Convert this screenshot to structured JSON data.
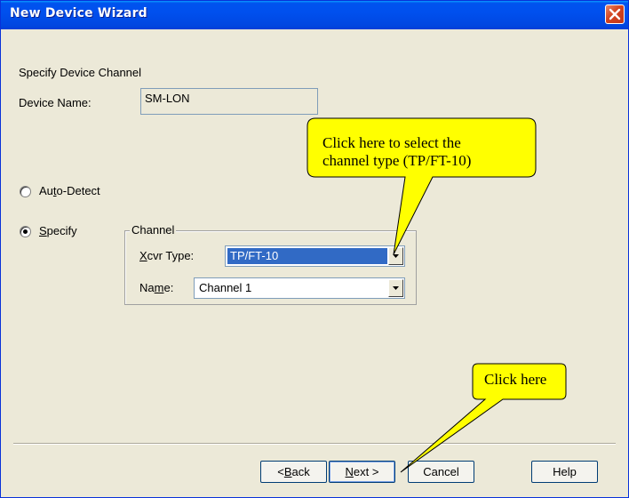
{
  "window": {
    "title": "New Device Wizard"
  },
  "page": {
    "heading": "Specify Device Channel",
    "device_name_label": "Device Name:",
    "device_name_value": "SM-LON"
  },
  "radios": {
    "auto_detect": {
      "label_hot": "Au",
      "label_ul": "t",
      "label_rest": "o-Detect",
      "checked": false
    },
    "specify": {
      "label_hot": "",
      "label_ul": "S",
      "label_rest": "pecify",
      "checked": true
    }
  },
  "channel_group": {
    "legend": "Channel",
    "xcvr_label_ul": "X",
    "xcvr_label_rest": "cvr Type:",
    "xcvr_value": "TP/FT-10",
    "name_label_hot": "Na",
    "name_label_ul": "m",
    "name_label_rest": "e:",
    "name_value": "Channel 1"
  },
  "callouts": {
    "xcvr_hint_line1": "Click here to select the",
    "xcvr_hint_line2": "channel type (TP/FT-10)",
    "next_hint": "Click here"
  },
  "buttons": {
    "back_pre": "< ",
    "back_ul": "B",
    "back_rest": "ack",
    "next_ul": "N",
    "next_rest": "ext >",
    "cancel": "Cancel",
    "help": "Help"
  },
  "colors": {
    "callout_fill": "#ffff00",
    "titlebar": "#0050ee",
    "selection": "#316ac5"
  }
}
